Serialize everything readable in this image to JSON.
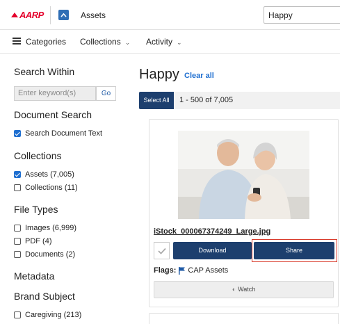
{
  "header": {
    "logo_text": "AARP",
    "app_title": "Assets",
    "search_value": "Happy"
  },
  "nav": {
    "categories": "Categories",
    "collections": "Collections",
    "activity": "Activity"
  },
  "sidebar": {
    "search_within_heading": "Search Within",
    "keyword_placeholder": "Enter keyword(s)",
    "go_label": "Go",
    "document_search_heading": "Document Search",
    "search_document_text": "Search Document Text",
    "collections_heading": "Collections",
    "assets_label": "Assets (7,005)",
    "collections_label": "Collections (11)",
    "file_types_heading": "File Types",
    "images_label": "Images (6,999)",
    "pdf_label": "PDF (4)",
    "documents_label": "Documents (2)",
    "metadata_heading": "Metadata",
    "brand_subject_heading": "Brand Subject",
    "caregiving_label": "Caregiving (213)"
  },
  "main": {
    "title": "Happy",
    "clear_all": "Clear all",
    "select_all": "Select All",
    "range_text": "1 - 500 of 7,005",
    "card": {
      "filename": "iStock_000067374249_Large.jpg",
      "download_label": "Download",
      "share_label": "Share",
      "flags_label": "Flags:",
      "flag_value": "CAP Assets",
      "watch_label": "Watch"
    }
  },
  "colors": {
    "brand_red": "#e4002b",
    "primary_button": "#1d3f6e",
    "link_blue": "#1f6fd0",
    "highlight_border": "#d93a2b"
  }
}
